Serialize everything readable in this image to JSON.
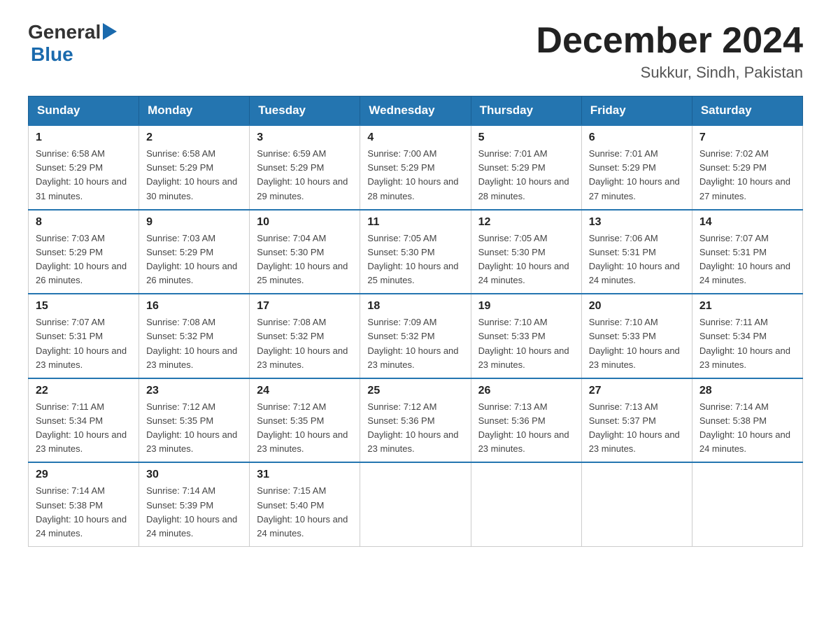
{
  "header": {
    "logo_general": "General",
    "logo_blue": "Blue",
    "title": "December 2024",
    "subtitle": "Sukkur, Sindh, Pakistan"
  },
  "days_header": [
    "Sunday",
    "Monday",
    "Tuesday",
    "Wednesday",
    "Thursday",
    "Friday",
    "Saturday"
  ],
  "weeks": [
    [
      {
        "date": "1",
        "sunrise": "6:58 AM",
        "sunset": "5:29 PM",
        "daylight": "10 hours and 31 minutes."
      },
      {
        "date": "2",
        "sunrise": "6:58 AM",
        "sunset": "5:29 PM",
        "daylight": "10 hours and 30 minutes."
      },
      {
        "date": "3",
        "sunrise": "6:59 AM",
        "sunset": "5:29 PM",
        "daylight": "10 hours and 29 minutes."
      },
      {
        "date": "4",
        "sunrise": "7:00 AM",
        "sunset": "5:29 PM",
        "daylight": "10 hours and 28 minutes."
      },
      {
        "date": "5",
        "sunrise": "7:01 AM",
        "sunset": "5:29 PM",
        "daylight": "10 hours and 28 minutes."
      },
      {
        "date": "6",
        "sunrise": "7:01 AM",
        "sunset": "5:29 PM",
        "daylight": "10 hours and 27 minutes."
      },
      {
        "date": "7",
        "sunrise": "7:02 AM",
        "sunset": "5:29 PM",
        "daylight": "10 hours and 27 minutes."
      }
    ],
    [
      {
        "date": "8",
        "sunrise": "7:03 AM",
        "sunset": "5:29 PM",
        "daylight": "10 hours and 26 minutes."
      },
      {
        "date": "9",
        "sunrise": "7:03 AM",
        "sunset": "5:29 PM",
        "daylight": "10 hours and 26 minutes."
      },
      {
        "date": "10",
        "sunrise": "7:04 AM",
        "sunset": "5:30 PM",
        "daylight": "10 hours and 25 minutes."
      },
      {
        "date": "11",
        "sunrise": "7:05 AM",
        "sunset": "5:30 PM",
        "daylight": "10 hours and 25 minutes."
      },
      {
        "date": "12",
        "sunrise": "7:05 AM",
        "sunset": "5:30 PM",
        "daylight": "10 hours and 24 minutes."
      },
      {
        "date": "13",
        "sunrise": "7:06 AM",
        "sunset": "5:31 PM",
        "daylight": "10 hours and 24 minutes."
      },
      {
        "date": "14",
        "sunrise": "7:07 AM",
        "sunset": "5:31 PM",
        "daylight": "10 hours and 24 minutes."
      }
    ],
    [
      {
        "date": "15",
        "sunrise": "7:07 AM",
        "sunset": "5:31 PM",
        "daylight": "10 hours and 23 minutes."
      },
      {
        "date": "16",
        "sunrise": "7:08 AM",
        "sunset": "5:32 PM",
        "daylight": "10 hours and 23 minutes."
      },
      {
        "date": "17",
        "sunrise": "7:08 AM",
        "sunset": "5:32 PM",
        "daylight": "10 hours and 23 minutes."
      },
      {
        "date": "18",
        "sunrise": "7:09 AM",
        "sunset": "5:32 PM",
        "daylight": "10 hours and 23 minutes."
      },
      {
        "date": "19",
        "sunrise": "7:10 AM",
        "sunset": "5:33 PM",
        "daylight": "10 hours and 23 minutes."
      },
      {
        "date": "20",
        "sunrise": "7:10 AM",
        "sunset": "5:33 PM",
        "daylight": "10 hours and 23 minutes."
      },
      {
        "date": "21",
        "sunrise": "7:11 AM",
        "sunset": "5:34 PM",
        "daylight": "10 hours and 23 minutes."
      }
    ],
    [
      {
        "date": "22",
        "sunrise": "7:11 AM",
        "sunset": "5:34 PM",
        "daylight": "10 hours and 23 minutes."
      },
      {
        "date": "23",
        "sunrise": "7:12 AM",
        "sunset": "5:35 PM",
        "daylight": "10 hours and 23 minutes."
      },
      {
        "date": "24",
        "sunrise": "7:12 AM",
        "sunset": "5:35 PM",
        "daylight": "10 hours and 23 minutes."
      },
      {
        "date": "25",
        "sunrise": "7:12 AM",
        "sunset": "5:36 PM",
        "daylight": "10 hours and 23 minutes."
      },
      {
        "date": "26",
        "sunrise": "7:13 AM",
        "sunset": "5:36 PM",
        "daylight": "10 hours and 23 minutes."
      },
      {
        "date": "27",
        "sunrise": "7:13 AM",
        "sunset": "5:37 PM",
        "daylight": "10 hours and 23 minutes."
      },
      {
        "date": "28",
        "sunrise": "7:14 AM",
        "sunset": "5:38 PM",
        "daylight": "10 hours and 24 minutes."
      }
    ],
    [
      {
        "date": "29",
        "sunrise": "7:14 AM",
        "sunset": "5:38 PM",
        "daylight": "10 hours and 24 minutes."
      },
      {
        "date": "30",
        "sunrise": "7:14 AM",
        "sunset": "5:39 PM",
        "daylight": "10 hours and 24 minutes."
      },
      {
        "date": "31",
        "sunrise": "7:15 AM",
        "sunset": "5:40 PM",
        "daylight": "10 hours and 24 minutes."
      },
      null,
      null,
      null,
      null
    ]
  ],
  "labels": {
    "sunrise": "Sunrise:",
    "sunset": "Sunset:",
    "daylight": "Daylight:"
  }
}
